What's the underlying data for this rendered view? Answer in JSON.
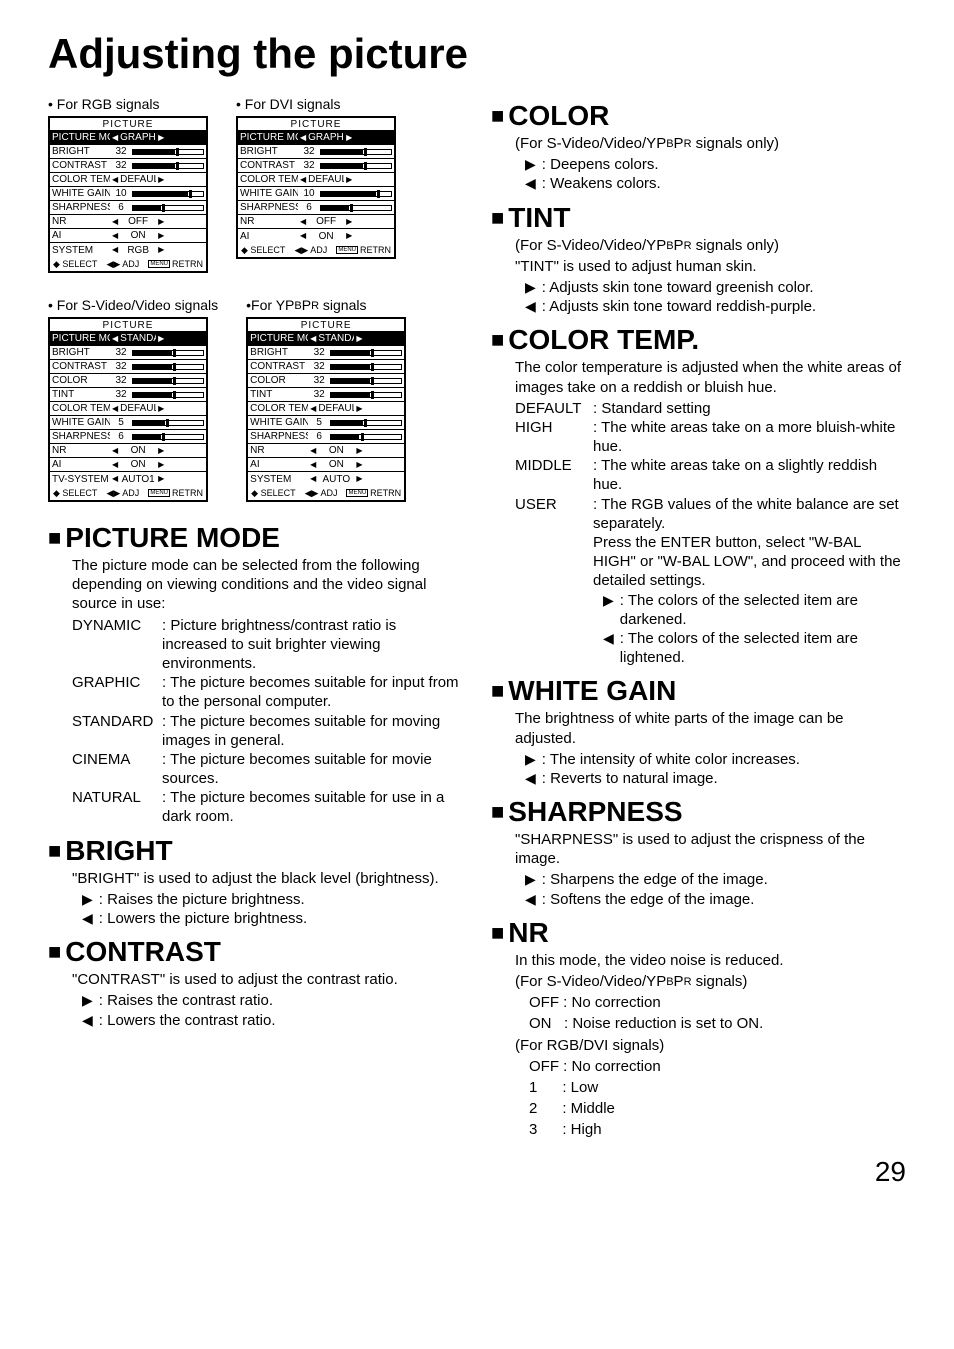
{
  "title": "Adjusting the picture",
  "pagenum": "29",
  "menus": {
    "rgb": {
      "caption": "• For RGB signals",
      "title": "PICTURE",
      "rows": [
        {
          "label": "PICTURE MODE",
          "type": "sel",
          "val": "GRAPHIC",
          "hi": true
        },
        {
          "label": "BRIGHT",
          "type": "bar",
          "val": "32",
          "fill": 60,
          "mark": 62
        },
        {
          "label": "CONTRAST",
          "type": "bar",
          "val": "32",
          "fill": 60,
          "mark": 62
        },
        {
          "label": "COLOR TEMP.",
          "type": "sel",
          "val": "DEFAULT"
        },
        {
          "label": "WHITE GAIN",
          "type": "bar",
          "val": "10",
          "fill": 78,
          "mark": 80
        },
        {
          "label": "SHARPNESS",
          "type": "bar",
          "val": "6",
          "fill": 40,
          "mark": 42
        },
        {
          "label": "NR",
          "type": "sel",
          "val": "OFF"
        },
        {
          "label": "AI",
          "type": "sel",
          "val": "ON"
        },
        {
          "label": "SYSTEM",
          "type": "sel",
          "val": "RGB"
        }
      ],
      "foot": {
        "a": "SELECT",
        "b": "ADJ",
        "c": "RETRN"
      }
    },
    "dvi": {
      "caption": "• For DVI signals",
      "title": "PICTURE",
      "rows": [
        {
          "label": "PICTURE MODE",
          "type": "sel",
          "val": "GRAPHIC",
          "hi": true
        },
        {
          "label": "BRIGHT",
          "type": "bar",
          "val": "32",
          "fill": 60,
          "mark": 62
        },
        {
          "label": "CONTRAST",
          "type": "bar",
          "val": "32",
          "fill": 60,
          "mark": 62
        },
        {
          "label": "COLOR TEMP.",
          "type": "sel",
          "val": "DEFAULT"
        },
        {
          "label": "WHITE GAIN",
          "type": "bar",
          "val": "10",
          "fill": 78,
          "mark": 80
        },
        {
          "label": "SHARPNESS",
          "type": "bar",
          "val": "6",
          "fill": 40,
          "mark": 42
        },
        {
          "label": "NR",
          "type": "sel",
          "val": "OFF"
        },
        {
          "label": "AI",
          "type": "sel",
          "val": "ON"
        }
      ],
      "foot": {
        "a": "SELECT",
        "b": "ADJ",
        "c": "RETRN"
      }
    },
    "svideo": {
      "caption": "• For S-Video/Video signals",
      "title": "PICTURE",
      "rows": [
        {
          "label": "PICTURE MODE",
          "type": "sel",
          "val": "STANDARD",
          "hi": true
        },
        {
          "label": "BRIGHT",
          "type": "bar",
          "val": "32",
          "fill": 55,
          "mark": 57
        },
        {
          "label": "CONTRAST",
          "type": "bar",
          "val": "32",
          "fill": 55,
          "mark": 57
        },
        {
          "label": "COLOR",
          "type": "bar",
          "val": "32",
          "fill": 55,
          "mark": 57
        },
        {
          "label": "TINT",
          "type": "bar",
          "val": "32",
          "fill": 55,
          "mark": 57
        },
        {
          "label": "COLOR TEMP.",
          "type": "sel",
          "val": "DEFAULT"
        },
        {
          "label": "WHITE GAIN",
          "type": "bar",
          "val": "5",
          "fill": 45,
          "mark": 47
        },
        {
          "label": "SHARPNESS",
          "type": "bar",
          "val": "6",
          "fill": 40,
          "mark": 42
        },
        {
          "label": "NR",
          "type": "sel",
          "val": "ON"
        },
        {
          "label": "AI",
          "type": "sel",
          "val": "ON"
        },
        {
          "label": "TV-SYSTEM",
          "type": "sel",
          "val": "AUTO1"
        }
      ],
      "foot": {
        "a": "SELECT",
        "b": "ADJ",
        "c": "RETRN"
      }
    },
    "ypbpr": {
      "caption": "•For YPBPR signals",
      "title": "PICTURE",
      "rows": [
        {
          "label": "PICTURE MODE",
          "type": "sel",
          "val": "STANDARD",
          "hi": true
        },
        {
          "label": "BRIGHT",
          "type": "bar",
          "val": "32",
          "fill": 55,
          "mark": 57
        },
        {
          "label": "CONTRAST",
          "type": "bar",
          "val": "32",
          "fill": 55,
          "mark": 57
        },
        {
          "label": "COLOR",
          "type": "bar",
          "val": "32",
          "fill": 55,
          "mark": 57
        },
        {
          "label": "TINT",
          "type": "bar",
          "val": "32",
          "fill": 55,
          "mark": 57
        },
        {
          "label": "COLOR TEMP.",
          "type": "sel",
          "val": "DEFAULT"
        },
        {
          "label": "WHITE GAIN",
          "type": "bar",
          "val": "5",
          "fill": 45,
          "mark": 47
        },
        {
          "label": "SHARPNESS",
          "type": "bar",
          "val": "6",
          "fill": 40,
          "mark": 42
        },
        {
          "label": "NR",
          "type": "sel",
          "val": "ON"
        },
        {
          "label": "AI",
          "type": "sel",
          "val": "ON"
        },
        {
          "label": "SYSTEM",
          "type": "sel",
          "val": "AUTO"
        }
      ],
      "foot": {
        "a": "SELECT",
        "b": "ADJ",
        "c": "RETRN"
      }
    }
  },
  "left_sections": {
    "picture_mode": {
      "h": "PICTURE MODE",
      "intro": "The picture mode can be selected from the following depending on viewing conditions and the video signal source in use:",
      "opts": [
        {
          "k": "DYNAMIC",
          "d": ": Picture brightness/contrast ratio is increased to suit brighter viewing environments."
        },
        {
          "k": "GRAPHIC",
          "d": ": The picture becomes suitable for input from to the personal computer."
        },
        {
          "k": "STANDARD",
          "d": ": The picture becomes suitable for moving images in general."
        },
        {
          "k": "CINEMA",
          "d": ": The picture becomes suitable for movie sources."
        },
        {
          "k": "NATURAL",
          "d": ": The picture becomes suitable for use in a dark room."
        }
      ]
    },
    "bright": {
      "h": "BRIGHT",
      "intro": "\"BRIGHT\" is used to adjust the black level (brightness).",
      "r": ": Raises the picture brightness.",
      "l": ": Lowers the picture brightness."
    },
    "contrast": {
      "h": "CONTRAST",
      "intro": "\"CONTRAST\" is used to adjust the contrast ratio.",
      "r": ": Raises the contrast ratio.",
      "l": ": Lowers the contrast ratio."
    }
  },
  "right_sections": {
    "color": {
      "h": "COLOR",
      "note": "(For S-Video/Video/YPBPR signals only)",
      "r": ": Deepens colors.",
      "l": ": Weakens colors."
    },
    "tint": {
      "h": "TINT",
      "note": "(For S-Video/Video/YPBPR signals only)",
      "intro": "\"TINT\" is used to adjust human skin.",
      "r": ": Adjusts skin tone toward greenish color.",
      "l": ": Adjusts skin tone toward reddish-purple."
    },
    "colortemp": {
      "h": "COLOR TEMP.",
      "intro": "The color temperature is adjusted when the white areas of images take on a reddish or bluish hue.",
      "opts": [
        {
          "k": "DEFAULT",
          "d": ": Standard setting"
        },
        {
          "k": "HIGH",
          "d": ": The white areas take on a more bluish-white hue."
        },
        {
          "k": "MIDDLE",
          "d": ": The white areas take on a slightly reddish hue."
        },
        {
          "k": "USER",
          "d": ": The RGB values of the white balance are set separately."
        }
      ],
      "user_extra": "Press the ENTER button, select \"W-BAL HIGH\" or \"W-BAL LOW\", and proceed with the detailed settings.",
      "sub_r": ": The colors of the selected item are darkened.",
      "sub_l": ": The colors of the selected item are lightened."
    },
    "whitegain": {
      "h": "WHITE GAIN",
      "intro": "The brightness of white parts of the image can be adjusted.",
      "r": ": The intensity of white color increases.",
      "l": ": Reverts to natural image."
    },
    "sharpness": {
      "h": "SHARPNESS",
      "intro": "\"SHARPNESS\" is used to adjust the crispness of the image.",
      "r": ": Sharpens the edge of the image.",
      "l": ": Softens the edge of the image."
    },
    "nr": {
      "h": "NR",
      "intro": "In this mode, the video noise is reduced.",
      "note1": "(For S-Video/Video/YPBPR signals)",
      "a1": "OFF : No correction",
      "a2": "ON   : Noise reduction is set to ON.",
      "note2": "(For RGB/DVI signals)",
      "b1": "OFF : No correction",
      "b2": "1      : Low",
      "b3": "2      : Middle",
      "b4": "3      : High"
    }
  }
}
